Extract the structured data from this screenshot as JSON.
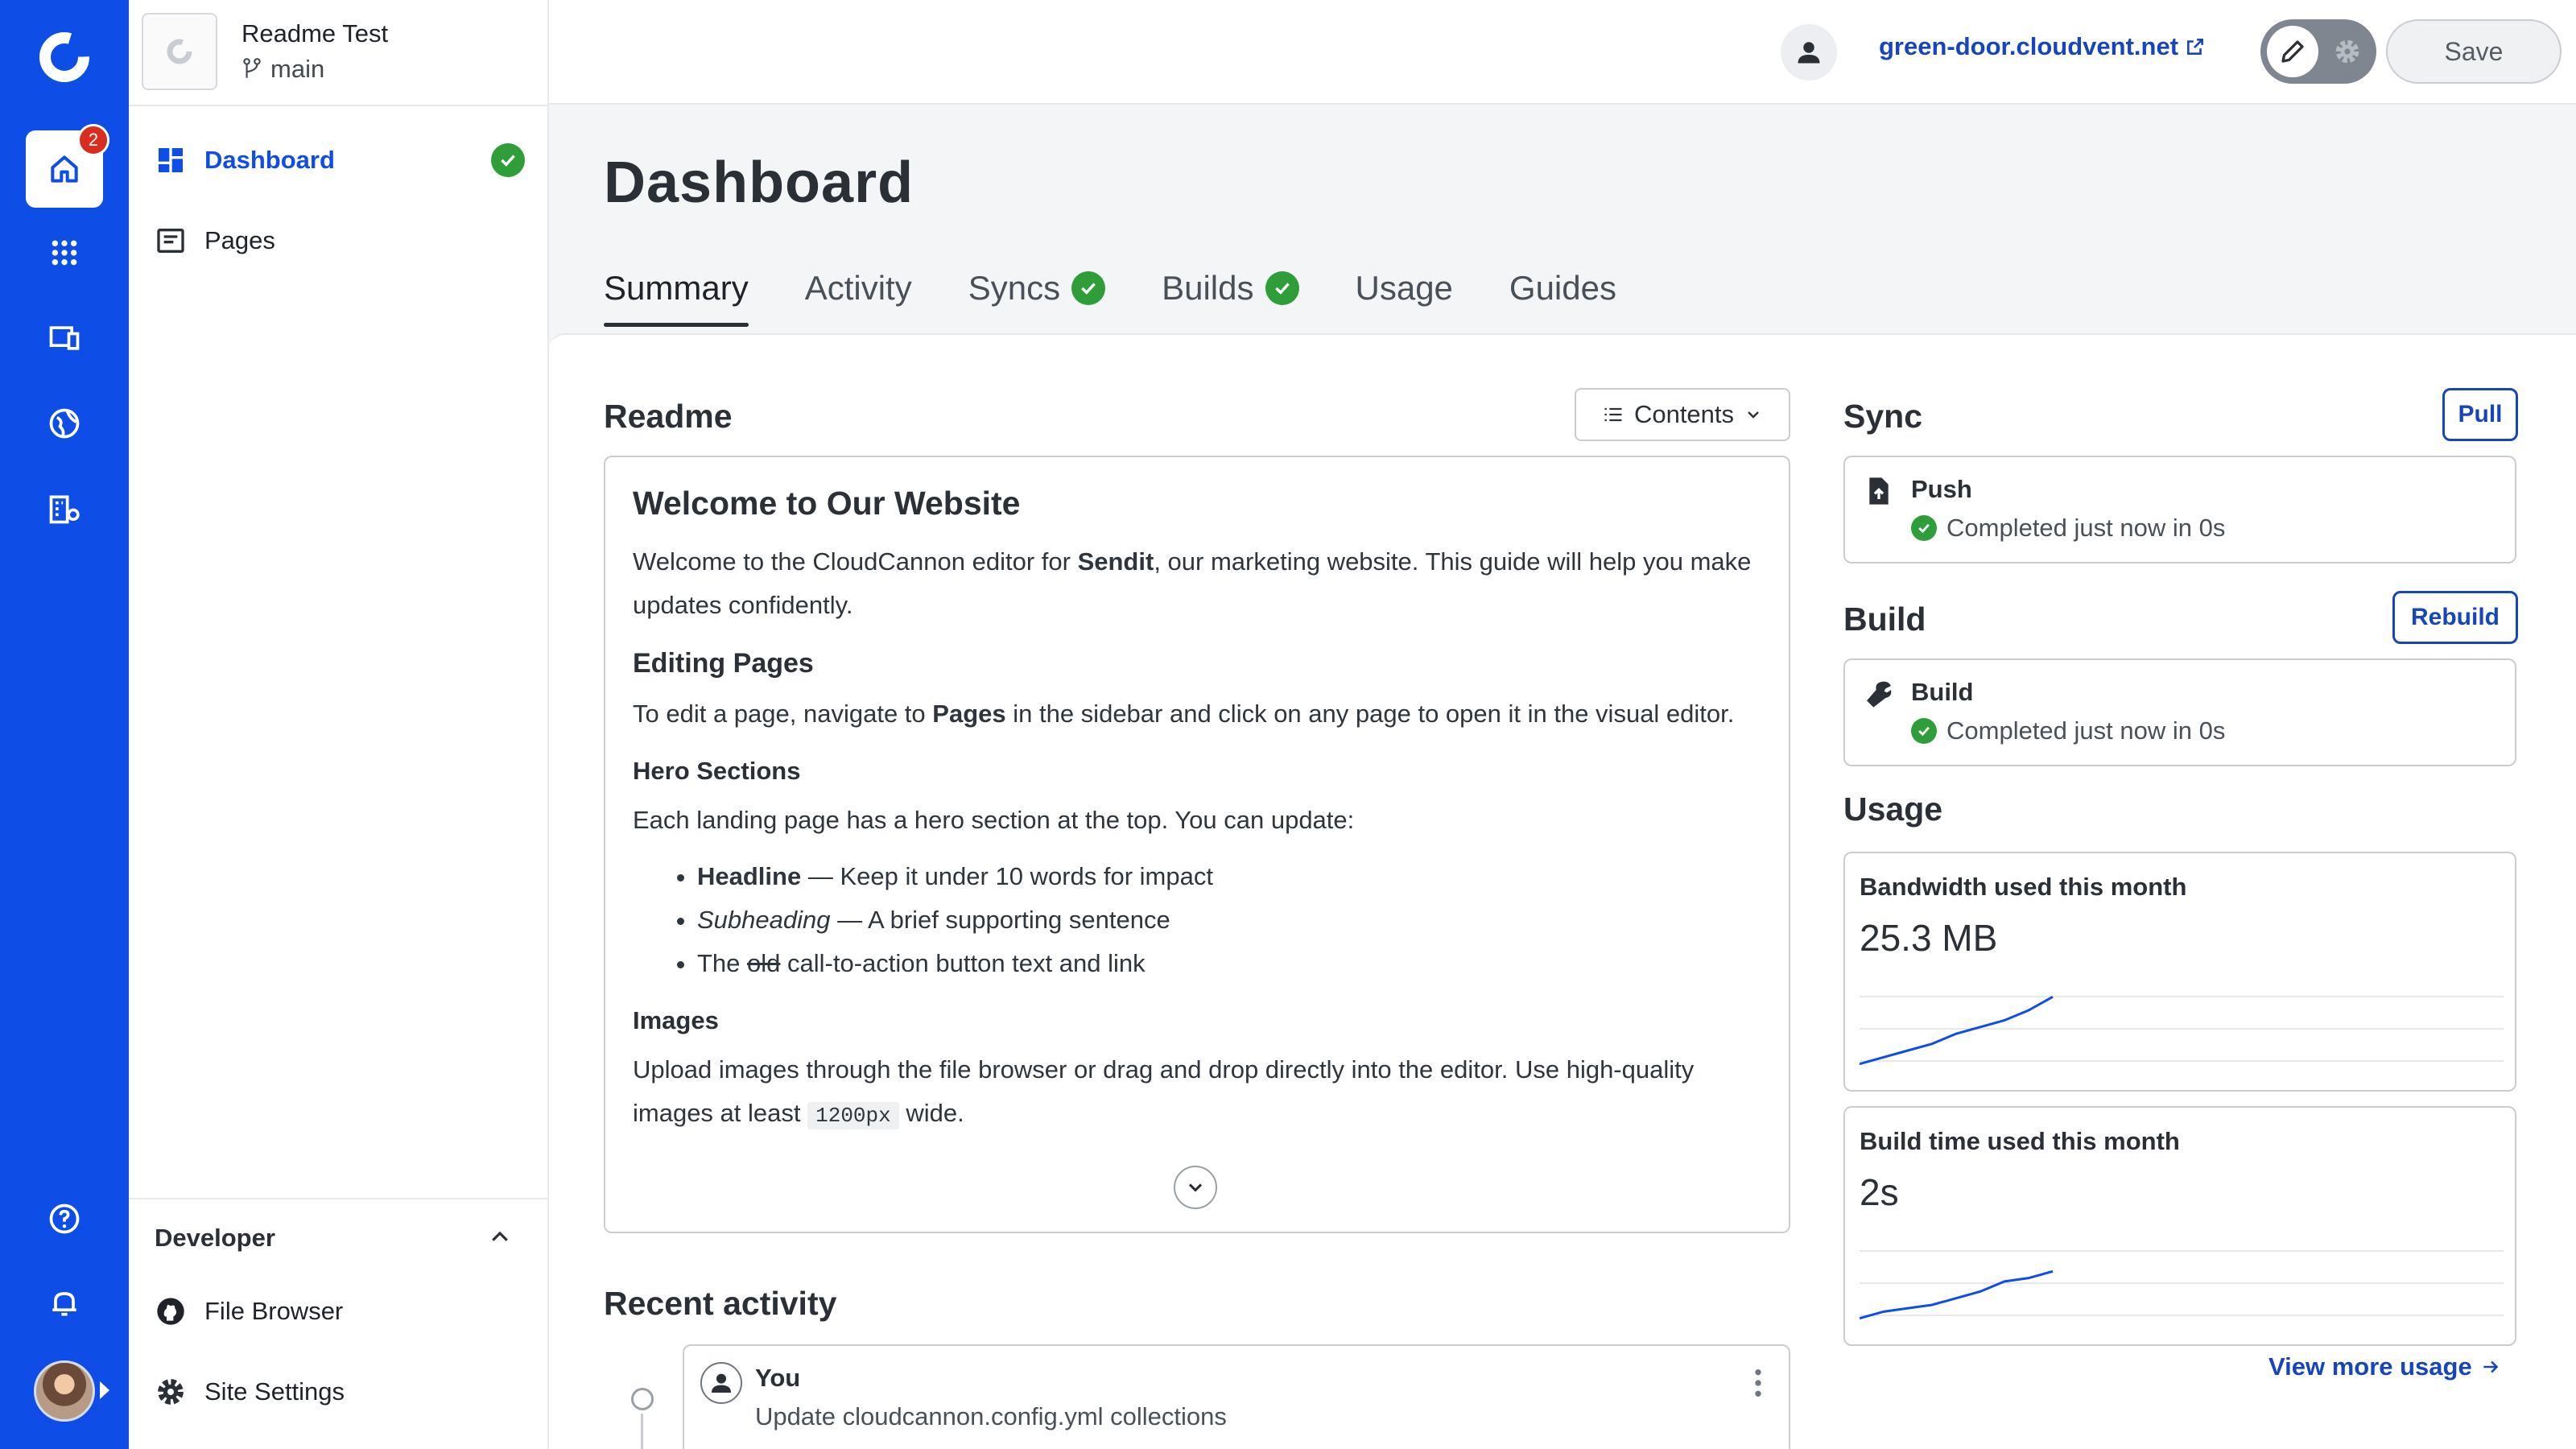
{
  "site": {
    "name": "Readme Test",
    "branch": "main"
  },
  "rail": {
    "notification_count": "2"
  },
  "sidebar": {
    "items": [
      {
        "label": "Dashboard"
      },
      {
        "label": "Pages"
      }
    ],
    "developer": {
      "title": "Developer",
      "items": [
        {
          "label": "File Browser"
        },
        {
          "label": "Site Settings"
        }
      ]
    }
  },
  "topbar": {
    "site_url": "green-door.cloudvent.net",
    "save_label": "Save"
  },
  "page": {
    "title": "Dashboard",
    "tabs": [
      {
        "label": "Summary"
      },
      {
        "label": "Activity"
      },
      {
        "label": "Syncs"
      },
      {
        "label": "Builds"
      },
      {
        "label": "Usage"
      },
      {
        "label": "Guides"
      }
    ]
  },
  "readme": {
    "title": "Readme",
    "contents_label": "Contents",
    "h1": "Welcome to Our Website",
    "intro_pre": "Welcome to the CloudCannon editor for ",
    "intro_bold": "Sendit",
    "intro_post": ", our marketing website. This guide will help you make updates confidently.",
    "h2_editing": "Editing Pages",
    "editing_pre": "To edit a page, navigate to ",
    "editing_bold": "Pages",
    "editing_post": " in the sidebar and click on any page to open it in the visual editor.",
    "h3_hero": "Hero Sections",
    "hero_text": "Each landing page has a hero section at the top. You can update:",
    "bullet1_bold": "Headline",
    "bullet1_rest": " — Keep it under 10 words for impact",
    "bullet2_italic": "Subheading",
    "bullet2_rest": " — A brief supporting sentence",
    "bullet3_pre": "The ",
    "bullet3_strike": "old",
    "bullet3_rest": " call-to-action button text and link",
    "h3_images": "Images",
    "images_pre": "Upload images through the file browser or drag and drop directly into the editor. Use high-quality images at least ",
    "images_code": "1200px",
    "images_post": " wide."
  },
  "activity": {
    "title": "Recent activity",
    "items": [
      {
        "user": "You",
        "description": "Update cloudcannon.config.yml collections"
      }
    ]
  },
  "sync": {
    "title": "Sync",
    "button": "Pull",
    "card_title": "Push",
    "card_status": "Completed just now in 0s"
  },
  "build": {
    "title": "Build",
    "button": "Rebuild",
    "card_title": "Build",
    "card_status": "Completed just now in 0s"
  },
  "usage": {
    "title": "Usage",
    "bandwidth": {
      "label": "Bandwidth used this month",
      "value": "25.3 MB",
      "trend": [
        2,
        4,
        6,
        8,
        11,
        13,
        15,
        18,
        22
      ]
    },
    "build_time": {
      "label": "Build time used this month",
      "value": "2s",
      "trend": [
        2,
        4,
        5,
        6,
        8,
        10,
        13,
        14,
        16
      ]
    },
    "more_link": "View more usage"
  },
  "colors": {
    "brand": "#0f4ee6",
    "link": "#1746b8",
    "success": "#2e9d3a",
    "danger": "#d92d20"
  }
}
